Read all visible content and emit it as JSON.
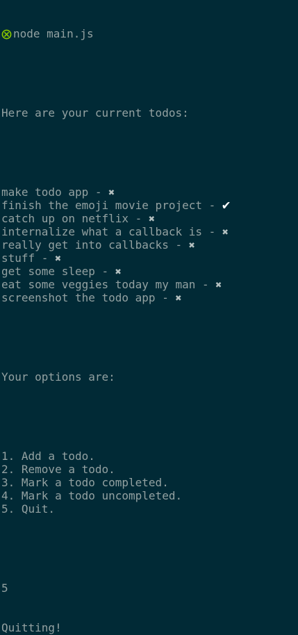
{
  "command": {
    "icon": "prompt-circle-icon",
    "icon_color": "#85c400",
    "text": "node main.js"
  },
  "todos_header": "Here are your current todos:",
  "todos": [
    {
      "text": "make todo app",
      "separator": " - ",
      "status": "✖",
      "done": false
    },
    {
      "text": "finish the emoji movie project",
      "separator": " - ",
      "status": "✔",
      "done": true
    },
    {
      "text": "catch up on netflix",
      "separator": " - ",
      "status": "✖",
      "done": false
    },
    {
      "text": "internalize what a callback is",
      "separator": " - ",
      "status": "✖",
      "done": false
    },
    {
      "text": "really get into callbacks",
      "separator": " - ",
      "status": "✖",
      "done": false
    },
    {
      "text": "stuff",
      "separator": " - ",
      "status": "✖",
      "done": false
    },
    {
      "text": "get some sleep",
      "separator": " - ",
      "status": "✖",
      "done": false
    },
    {
      "text": "eat some veggies today my man",
      "separator": " - ",
      "status": "✖",
      "done": false
    },
    {
      "text": "screenshot the todo app",
      "separator": " - ",
      "status": "✖",
      "done": false
    }
  ],
  "options_header": "Your options are:",
  "options": [
    "1. Add a todo.",
    "2. Remove a todo.",
    "3. Mark a todo completed.",
    "4. Mark a todo uncompleted.",
    "5. Quit."
  ],
  "user_input": "5",
  "exit_message": "Quitting!",
  "colors": {
    "background": "#012a36",
    "text": "#93a1a1",
    "checkmark": "#ffffff"
  }
}
